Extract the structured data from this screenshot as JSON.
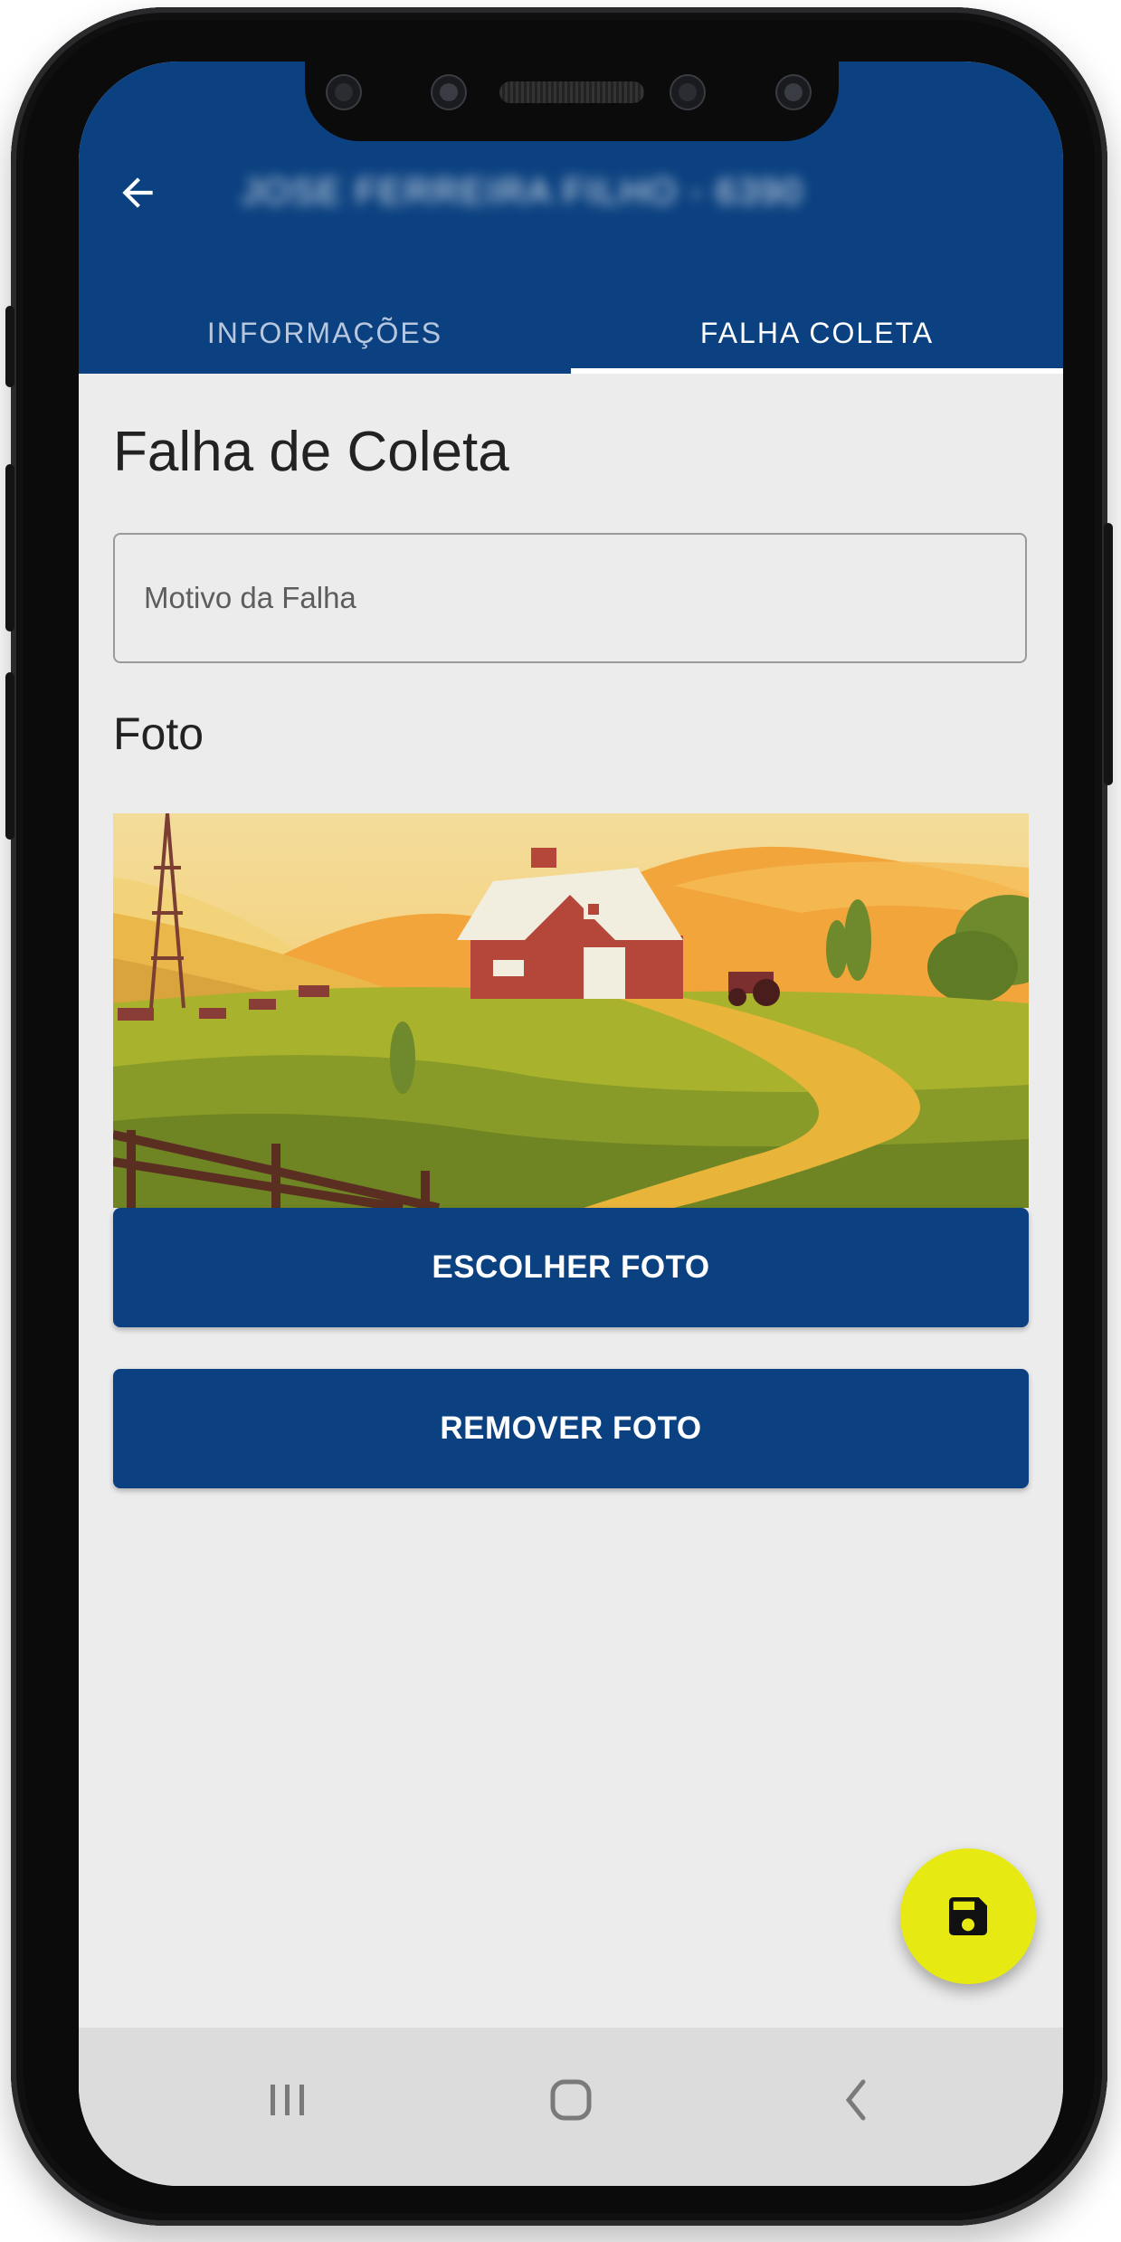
{
  "header": {
    "title": "JOSE FERREIRA FILHO - 63903",
    "back_icon": "arrow-back-icon"
  },
  "tabs": [
    {
      "label": "INFORMAÇÕES",
      "active": false
    },
    {
      "label": "FALHA COLETA",
      "active": true
    }
  ],
  "form": {
    "title": "Falha de Coleta",
    "motivo_placeholder": "Motivo da Falha",
    "motivo_value": "",
    "photo_label": "Foto",
    "photo_subject": "farm-illustration",
    "choose_photo_label": "ESCOLHER FOTO",
    "remove_photo_label": "REMOVER FOTO"
  },
  "fab": {
    "icon": "save-icon"
  },
  "navbar": {
    "icons": [
      "recent-apps-icon",
      "home-icon",
      "back-icon"
    ]
  },
  "colors": {
    "primary": "#0b4180",
    "fab": "#e6ea12",
    "background": "#ececec"
  }
}
